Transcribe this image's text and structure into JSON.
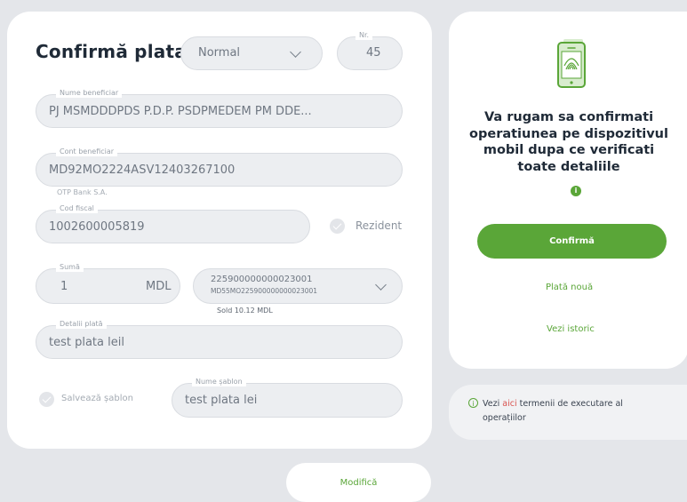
{
  "form": {
    "title": "Confirmă plata",
    "type_select": "Normal",
    "nr_label": "Nr.",
    "nr_value": "45",
    "beneficiary_name_label": "Nume beneficiar",
    "beneficiary_name": "PJ MSMDDDPDS P.D.P. PSDPMEDEM PM DDE...",
    "account_label": "Cont beneficiar",
    "account": "MD92MO2224ASV12403267100",
    "bank": "OTP Bank S.A.",
    "fiscal_label": "Cod fiscal",
    "fiscal": "1002600005819",
    "resident_label": "Rezident",
    "amount_label": "Sumă",
    "amount": "1",
    "currency": "MDL",
    "source_account": "225900000000023001",
    "source_iban": "MD55MO225900000000023001",
    "balance": "Sold 10.12 MDL",
    "details_label": "Detalii plată",
    "details": "test plata leil",
    "save_template_label": "Salvează șablon",
    "template_name_label": "Nume șablon",
    "template_name": "test plata lei",
    "modify_button": "Modifică"
  },
  "confirm": {
    "message": "Va rugam sa confirmati operatiunea pe dispozitivul mobil dupa ce verificati toate detaliile",
    "info_badge": "i",
    "confirm_button": "Confirmă",
    "new_payment": "Plată nouă",
    "history": "Vezi istoric"
  },
  "terms": {
    "prefix": "Vezi ",
    "link": "aici",
    "suffix": " termenii de executare al operațiilor",
    "icon": "i"
  },
  "colors": {
    "accent": "#5aa638",
    "text_dark": "#1f2a37",
    "field_bg": "#eceef1"
  }
}
